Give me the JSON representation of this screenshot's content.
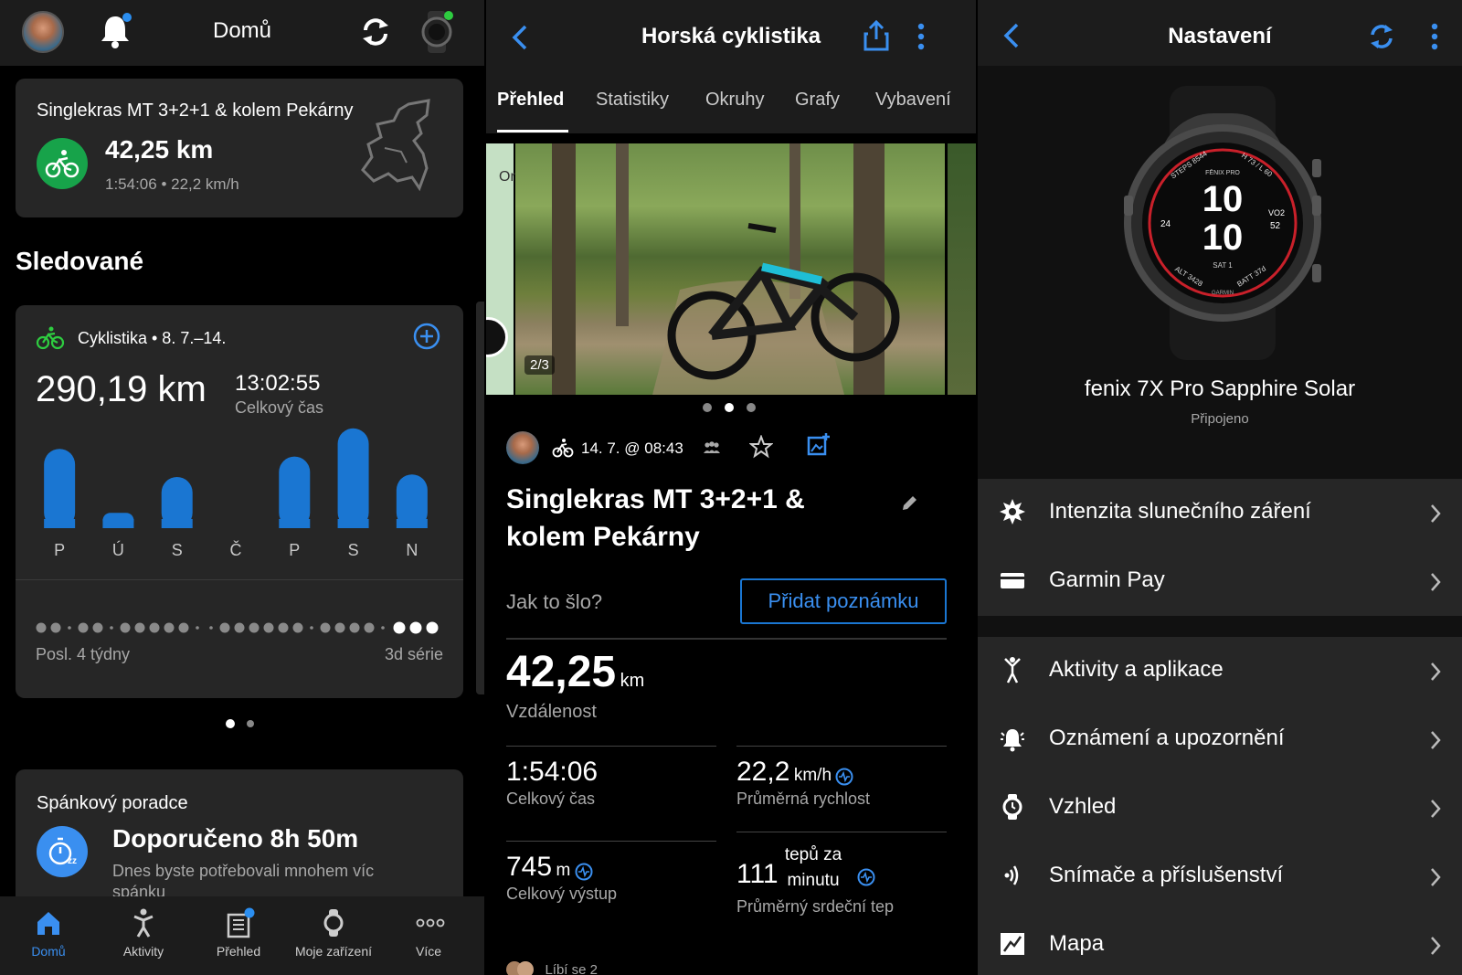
{
  "home": {
    "header_title": "Domů",
    "activity_card": {
      "title": "Singlekras MT 3+2+1 & kolem Pekárny",
      "distance": "42,25 km",
      "meta": "1:54:06 • 22,2 km/h"
    },
    "section_title": "Sledované",
    "tracked": {
      "label": "Cyklistika • 8. 7.–14.",
      "total_distance": "290,19 km",
      "total_time": "13:02:55",
      "total_time_label": "Celkový čas",
      "days": [
        "P",
        "Ú",
        "S",
        "Č",
        "P",
        "S",
        "N"
      ],
      "day_values": [
        0.62,
        0.12,
        0.4,
        0,
        0.56,
        0.78,
        0.42
      ],
      "streak_left": "Posl. 4 týdny",
      "streak_right": "3d série"
    },
    "sleep_card": {
      "title": "Spánkový poradce",
      "headline": "Doporučeno 8h 50m",
      "body": "Dnes byste potřebovali mnohem víc spánku"
    },
    "tabs": [
      "Domů",
      "Aktivity",
      "Přehled",
      "Moje zařízení",
      "Více"
    ]
  },
  "activity": {
    "header_title": "Horská cyklistika",
    "tabs": [
      "Přehled",
      "Statistiky",
      "Okruhy",
      "Grafy",
      "Vybavení"
    ],
    "photo_counter": "2/3",
    "photo_side_letter": "Or",
    "date": "14. 7. @ 08:43",
    "title": "Singlekras MT 3+2+1 & kolem Pekárny",
    "how_was_it": "Jak to šlo?",
    "add_note": "Přidat poznámku",
    "distance_value": "42,25",
    "distance_unit": "km",
    "distance_label": "Vzdálenost",
    "stats": [
      {
        "value": "1:54:06",
        "unit": "",
        "label": "Celkový čas"
      },
      {
        "value": "22,2",
        "unit": "km/h",
        "label": "Průměrná rychlost"
      },
      {
        "value": "745",
        "unit": "m",
        "label": "Celkový výstup"
      },
      {
        "value": "111",
        "unit": "tepů za minutu",
        "label": "Průměrný srdeční tep"
      }
    ],
    "likes": "Líbí se 2"
  },
  "settings": {
    "header_title": "Nastavení",
    "device_name": "fenix 7X Pro Sapphire Solar",
    "device_status": "Připojeno",
    "watch_face": {
      "hour": "10",
      "minute": "10",
      "top_left": "STEPS 8544",
      "top_right": "H 73 / L 60",
      "brand": "FĒNIX PRO",
      "left_value": "24",
      "right_label": "VO2",
      "right_value": "52",
      "day": "SAT 1",
      "bottom_left": "ALT 3428",
      "bottom_right": "BATT 37d",
      "maker": "GARMIN"
    },
    "group1": [
      "Intenzita slunečního záření",
      "Garmin Pay"
    ],
    "group2": [
      "Aktivity a aplikace",
      "Oznámení a upozornění",
      "Vzhled",
      "Snímače a příslušenství",
      "Mapa"
    ]
  }
}
